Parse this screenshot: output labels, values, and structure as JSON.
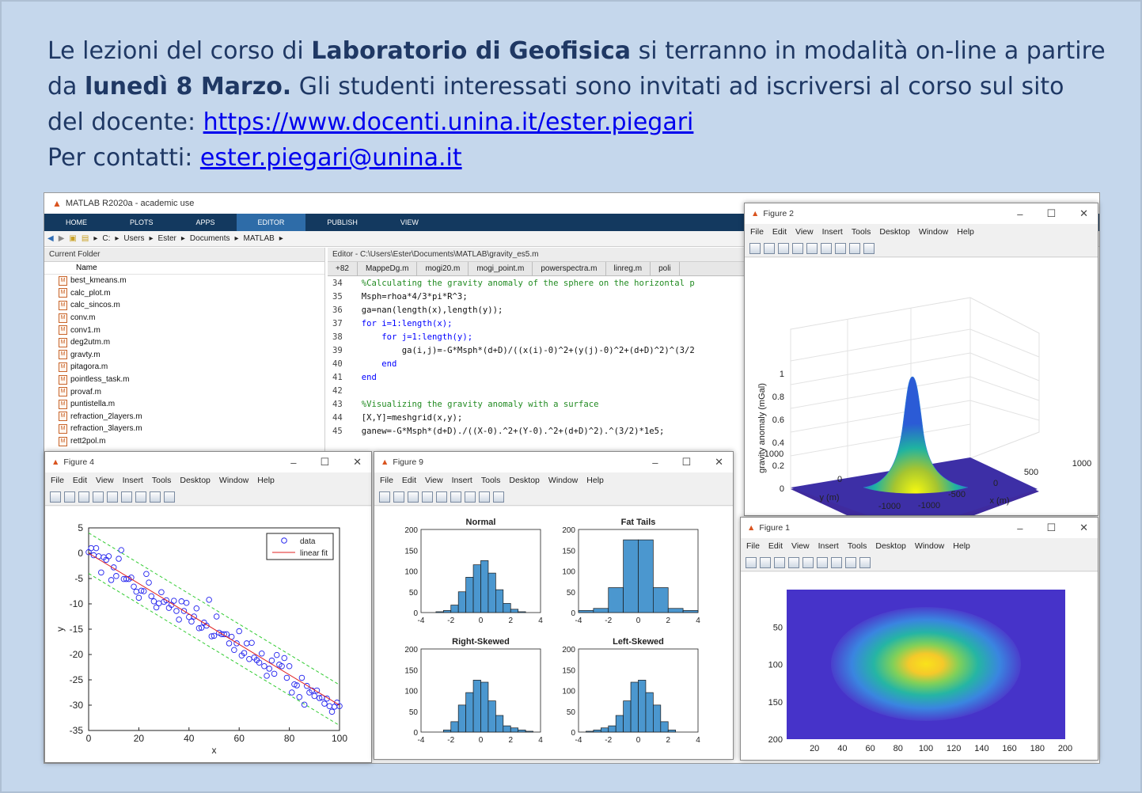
{
  "announcement": {
    "line1_pre": "Le lezioni del corso di ",
    "line1_bold": "Laboratorio di Geofisica",
    "line1_post": " si terranno in modalità on-line a partire",
    "line2_pre": "da ",
    "line2_bold": "lunedì 8 Marzo.",
    "line2_post": " Gli studenti interessati sono invitati ad iscriversi al corso sul sito",
    "line3_pre": "del docente: ",
    "line3_link": "https://www.docenti.unina.it/ester.piegari",
    "line4_pre": "Per contatti: ",
    "line4_link": "ester.piegari@unina.it"
  },
  "matlab": {
    "title": "MATLAB R2020a - academic use",
    "ribbon_tabs": [
      "HOME",
      "PLOTS",
      "APPS",
      "EDITOR",
      "PUBLISH",
      "VIEW"
    ],
    "path": [
      "C:",
      "Users",
      "Ester",
      "Documents",
      "MATLAB"
    ],
    "current_folder_label": "Current Folder",
    "name_header": "Name",
    "files": [
      "best_kmeans.m",
      "calc_plot.m",
      "calc_sincos.m",
      "conv.m",
      "conv1.m",
      "deg2utm.m",
      "gravty.m",
      "pitagora.m",
      "pointless_task.m",
      "provaf.m",
      "puntistella.m",
      "refraction_2layers.m",
      "refraction_3layers.m",
      "rett2pol.m"
    ],
    "editor_title": "Editor - C:\\Users\\Ester\\Documents\\MATLAB\\gravity_es5.m",
    "editor_tabs": [
      "+82",
      "MappeDg.m",
      "mogi20.m",
      "mogi_point.m",
      "powerspectra.m",
      "linreg.m",
      "poli"
    ],
    "code": [
      {
        "n": "34",
        "t": "  %Calculating the gravity anomaly of the sphere on the horizontal p",
        "k": "cm"
      },
      {
        "n": "35",
        "t": "  Msph=rhoa*4/3*pi*R^3;",
        "k": "tx"
      },
      {
        "n": "36",
        "t": "  ga=nan(length(x),length(y));",
        "k": "tx"
      },
      {
        "n": "37",
        "t": "  for i=1:length(x);",
        "k": "kw"
      },
      {
        "n": "38",
        "t": "      for j=1:length(y);",
        "k": "kw"
      },
      {
        "n": "39",
        "t": "          ga(i,j)=-G*Msph*(d+D)/((x(i)-0)^2+(y(j)-0)^2+(d+D)^2)^(3/2",
        "k": "tx"
      },
      {
        "n": "40",
        "t": "      end",
        "k": "kw"
      },
      {
        "n": "41",
        "t": "  end",
        "k": "kw"
      },
      {
        "n": "42",
        "t": "",
        "k": "tx"
      },
      {
        "n": "43",
        "t": "  %Visualizing the gravity anomaly with a surface",
        "k": "cm"
      },
      {
        "n": "44",
        "t": "  [X,Y]=meshgrid(x,y);",
        "k": "tx"
      },
      {
        "n": "45",
        "t": "  ganew=-G*Msph*(d+D)./((X-0).^2+(Y-0).^2+(d+D)^2).^(3/2)*1e5;",
        "k": "tx"
      }
    ]
  },
  "figure_menu": [
    "File",
    "Edit",
    "View",
    "Insert",
    "Tools",
    "Desktop",
    "Window",
    "Help"
  ],
  "fig2": {
    "title": "Figure 2"
  },
  "fig4": {
    "title": "Figure 4"
  },
  "fig9": {
    "title": "Figure 9"
  },
  "fig1": {
    "title": "Figure 1"
  },
  "chart_data": [
    {
      "id": "fig4",
      "type": "scatter",
      "xlabel": "x",
      "ylabel": "y",
      "xlim": [
        0,
        100
      ],
      "ylim": [
        -35,
        5
      ],
      "xticks": [
        0,
        20,
        40,
        60,
        80,
        100
      ],
      "yticks": [
        5,
        0,
        -5,
        -10,
        -15,
        -20,
        -25,
        -30,
        -35
      ],
      "legend": [
        "data",
        "linear fit"
      ],
      "legend_position": "top-right",
      "fit": {
        "intercept": 0,
        "slope": -0.3,
        "band": 4
      },
      "series": [
        {
          "name": "data",
          "x": [
            0,
            1,
            2,
            3,
            4,
            5,
            6,
            7,
            8,
            9,
            10,
            11,
            12,
            13,
            14,
            15,
            16,
            17,
            18,
            19,
            20,
            21,
            22,
            23,
            24,
            25,
            26,
            27,
            28,
            29,
            30,
            31,
            32,
            33,
            34,
            35,
            36,
            37,
            38,
            39,
            40,
            41,
            42,
            43,
            44,
            45,
            46,
            47,
            48,
            49,
            50,
            51,
            52,
            53,
            54,
            55,
            56,
            57,
            58,
            59,
            60,
            61,
            62,
            63,
            64,
            65,
            66,
            67,
            68,
            69,
            70,
            71,
            72,
            73,
            74,
            75,
            76,
            77,
            78,
            79,
            80,
            81,
            82,
            83,
            84,
            85,
            86,
            87,
            88,
            89,
            90,
            91,
            92,
            93,
            94,
            95,
            96,
            97,
            98,
            99,
            100
          ],
          "y": [
            0.2,
            1,
            -0.4,
            1,
            -0.6,
            -3.8,
            -0.8,
            -1.3,
            -0.6,
            -5.3,
            -2.8,
            -4.5,
            -1.1,
            0.6,
            -5.1,
            -5.1,
            -5.1,
            -4.8,
            -6.6,
            -7.6,
            -8.8,
            -7.4,
            -7.5,
            -4.1,
            -5.8,
            -8.5,
            -9.5,
            -10.7,
            -9.9,
            -7.7,
            -9.6,
            -9.3,
            -10.8,
            -10.2,
            -9.4,
            -11.4,
            -13.1,
            -9.5,
            -11.4,
            -9.8,
            -12.6,
            -13.5,
            -12.5,
            -10.9,
            -14.8,
            -14.7,
            -13.7,
            -14.3,
            -9.2,
            -16.4,
            -16.3,
            -12.5,
            -15.7,
            -16,
            -16,
            -16,
            -17.8,
            -16.5,
            -19.1,
            -17.8,
            -15.4,
            -20.2,
            -19.7,
            -17.8,
            -20.9,
            -17.7,
            -20.6,
            -21.1,
            -21.6,
            -19.8,
            -22.3,
            -24.2,
            -22.8,
            -21.2,
            -23.8,
            -20.1,
            -22,
            -22.3,
            -20.7,
            -24.6,
            -22.3,
            -27.5,
            -25.9,
            -26.1,
            -28.4,
            -24.6,
            -29.9,
            -26.2,
            -27.5,
            -27.1,
            -28.2,
            -27.1,
            -28.6,
            -28.5,
            -29.7,
            -28.7,
            -30.2,
            -31.3,
            -30.3,
            -29.5,
            -30.2
          ]
        }
      ]
    },
    {
      "id": "normal",
      "type": "bar",
      "title": "Normal",
      "xlim": [
        -4,
        4
      ],
      "ylim": [
        0,
        200
      ],
      "bin_edges": [
        -3,
        -2.5,
        -2,
        -1.5,
        -1,
        -0.5,
        0,
        0.5,
        1,
        1.5,
        2,
        2.5,
        3
      ],
      "values": [
        2,
        5,
        18,
        50,
        85,
        115,
        125,
        95,
        55,
        22,
        8,
        2
      ]
    },
    {
      "id": "fat",
      "type": "bar",
      "title": "Fat Tails",
      "xlim": [
        -4,
        4
      ],
      "ylim": [
        0,
        200
      ],
      "bin_edges": [
        -4,
        -3,
        -2,
        -1,
        0,
        1,
        2,
        3,
        4
      ],
      "values": [
        5,
        10,
        60,
        175,
        175,
        60,
        10,
        5
      ]
    },
    {
      "id": "right",
      "type": "bar",
      "title": "Right-Skewed",
      "xlim": [
        -4,
        4
      ],
      "ylim": [
        0,
        200
      ],
      "bin_edges": [
        -2.5,
        -2,
        -1.5,
        -1,
        -0.5,
        0,
        0.5,
        1,
        1.5,
        2,
        2.5,
        3,
        3.5
      ],
      "values": [
        5,
        25,
        65,
        95,
        125,
        120,
        75,
        40,
        15,
        10,
        5,
        2
      ]
    },
    {
      "id": "left",
      "type": "bar",
      "title": "Left-Skewed",
      "xlim": [
        -4,
        4
      ],
      "ylim": [
        0,
        200
      ],
      "bin_edges": [
        -3.5,
        -3,
        -2.5,
        -2,
        -1.5,
        -1,
        -0.5,
        0,
        0.5,
        1,
        1.5,
        2,
        2.5
      ],
      "values": [
        2,
        5,
        10,
        15,
        40,
        75,
        120,
        125,
        95,
        65,
        25,
        5
      ]
    },
    {
      "id": "fig2",
      "type": "surface",
      "zlabel": "gravity anomaly (mGal)",
      "xlabel": "x (m)",
      "ylabel": "y (m)",
      "zticks": [
        0,
        0.2,
        0.4,
        0.6,
        0.8,
        1
      ],
      "xticks": [
        -1000,
        -500,
        0,
        500,
        1000
      ],
      "yticks": [
        1000,
        0,
        -1000
      ]
    },
    {
      "id": "fig1",
      "type": "heatmap",
      "xticks": [
        20,
        40,
        60,
        80,
        100,
        120,
        140,
        160,
        180,
        200
      ],
      "yticks": [
        50,
        100,
        150,
        200
      ],
      "xlim": [
        0,
        200
      ],
      "ylim": [
        0,
        200
      ]
    }
  ]
}
